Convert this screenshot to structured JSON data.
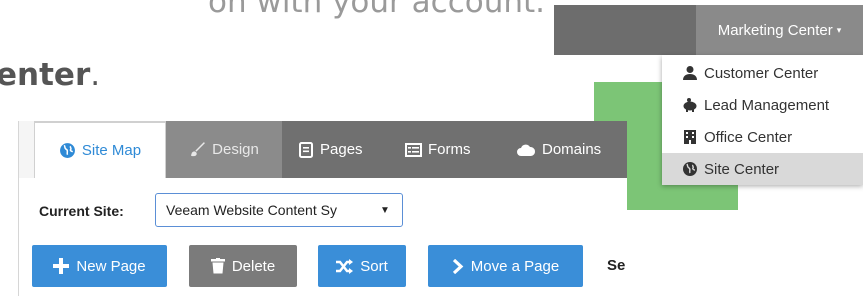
{
  "doc": {
    "line1": "on with your account.",
    "line2_bold": "enter",
    "line2_rest": "."
  },
  "header": {
    "menu_label": "Marketing Center"
  },
  "dropdown": {
    "items": [
      {
        "label": "Customer Center",
        "icon": "person-icon"
      },
      {
        "label": "Lead Management",
        "icon": "piggy-bank-icon"
      },
      {
        "label": "Office Center",
        "icon": "building-icon"
      },
      {
        "label": "Site Center",
        "icon": "globe-icon",
        "active": true
      }
    ]
  },
  "tabs": [
    {
      "label": "Site Map",
      "icon": "globe-icon",
      "active": true
    },
    {
      "label": "Design",
      "icon": "brush-icon"
    },
    {
      "label": "Pages",
      "icon": "page-icon"
    },
    {
      "label": "Forms",
      "icon": "form-icon"
    },
    {
      "label": "Domains",
      "icon": "cloud-icon"
    }
  ],
  "site": {
    "label": "Current Site:",
    "selected": "Veeam Website Content Sy"
  },
  "actions": {
    "new_page": "New Page",
    "delete": "Delete",
    "sort": "Sort",
    "move": "Move a Page",
    "trailing": "Se"
  },
  "colors": {
    "accent_blue": "#3a8ed8",
    "tab_gray": "#707070",
    "menu_gray": "#8a8a8a",
    "green": "#7cc576"
  }
}
